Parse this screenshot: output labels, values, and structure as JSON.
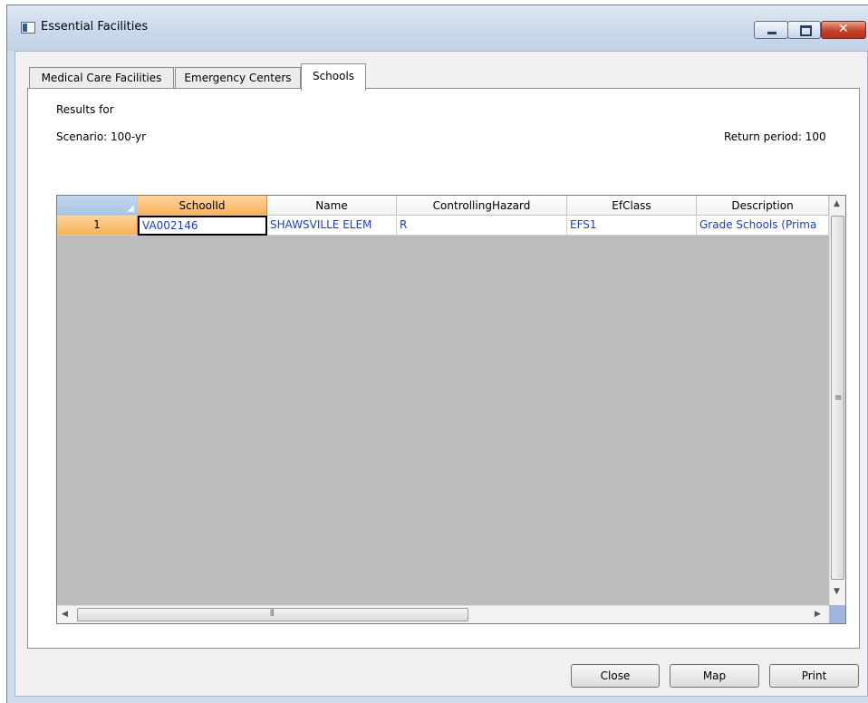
{
  "window": {
    "title": "Essential Facilities",
    "controls": {
      "minimize_icon": "minimize-icon",
      "maximize_icon": "maximize-icon",
      "close_icon": "close-icon"
    }
  },
  "tabs": [
    {
      "label": "Medical Care Facilities",
      "selected": false
    },
    {
      "label": "Emergency Centers",
      "selected": false
    },
    {
      "label": "Schools",
      "selected": true
    }
  ],
  "panel": {
    "results_for": "Results for",
    "scenario": "Scenario: 100-yr",
    "return_period": "Return period: 100"
  },
  "grid": {
    "columns": [
      "SchoolId",
      "Name",
      "ControllingHazard",
      "EfClass",
      "Description"
    ],
    "rows": [
      {
        "row_number": "1",
        "cells": [
          "VA002146",
          "SHAWSVILLE ELEM",
          "R",
          "EFS1",
          "Grade Schools (Prima"
        ]
      }
    ],
    "selected_column": "SchoolId"
  },
  "buttons": {
    "close": "Close",
    "map": "Map",
    "print": "Print"
  },
  "colors": {
    "selection_header": "#f6b25d",
    "cell_text": "#1a3cd6",
    "grid_background": "#bdbdbd"
  }
}
